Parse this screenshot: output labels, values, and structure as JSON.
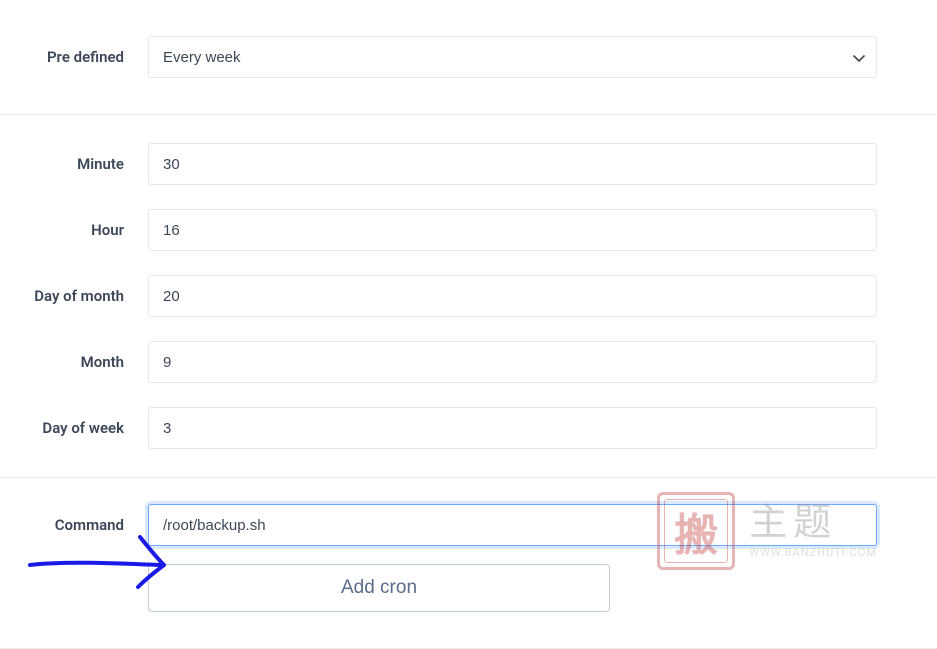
{
  "predefined": {
    "label": "Pre defined",
    "selected": "Every week"
  },
  "fields": {
    "minute": {
      "label": "Minute",
      "value": "30"
    },
    "hour": {
      "label": "Hour",
      "value": "16"
    },
    "dayOfMonth": {
      "label": "Day of month",
      "value": "20"
    },
    "month": {
      "label": "Month",
      "value": "9"
    },
    "dayOfWeek": {
      "label": "Day of week",
      "value": "3"
    }
  },
  "command": {
    "label": "Command",
    "value": "/root/backup.sh"
  },
  "addButton": "Add cron",
  "watermark": {
    "stamp": "搬",
    "main": "主题",
    "sub": "WWW.BANZHUTI.COM"
  }
}
